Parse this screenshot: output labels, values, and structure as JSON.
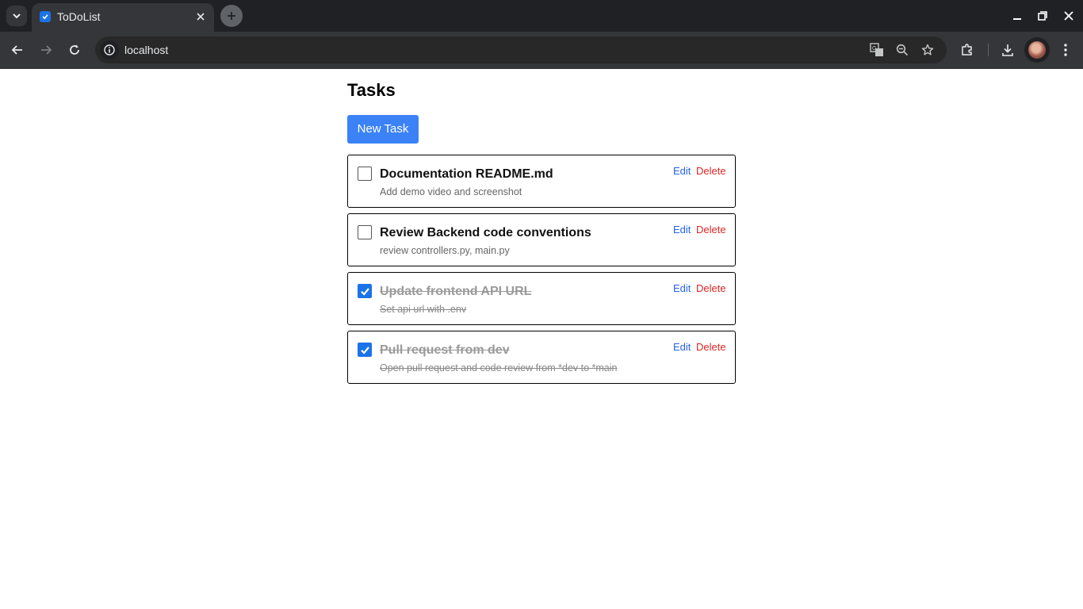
{
  "browser": {
    "tab_title": "ToDoList",
    "url": "localhost"
  },
  "page": {
    "title": "Tasks",
    "new_task_label": "New Task"
  },
  "actions": {
    "edit_label": "Edit",
    "delete_label": "Delete"
  },
  "tasks": [
    {
      "title": "Documentation README.md",
      "description": "Add demo video and screenshot",
      "completed": false
    },
    {
      "title": "Review Backend code conventions",
      "description": "review controllers.py, main.py",
      "completed": false
    },
    {
      "title": "Update frontend API URL",
      "description": "Set api url with .env",
      "completed": true
    },
    {
      "title": "Pull request from dev",
      "description": "Open pull request and code review from *dev to *main",
      "completed": true
    }
  ],
  "colors": {
    "primary": "#3b82f6",
    "edit": "#2563eb",
    "delete": "#dc2626",
    "checkbox_checked": "#1a73e8"
  }
}
